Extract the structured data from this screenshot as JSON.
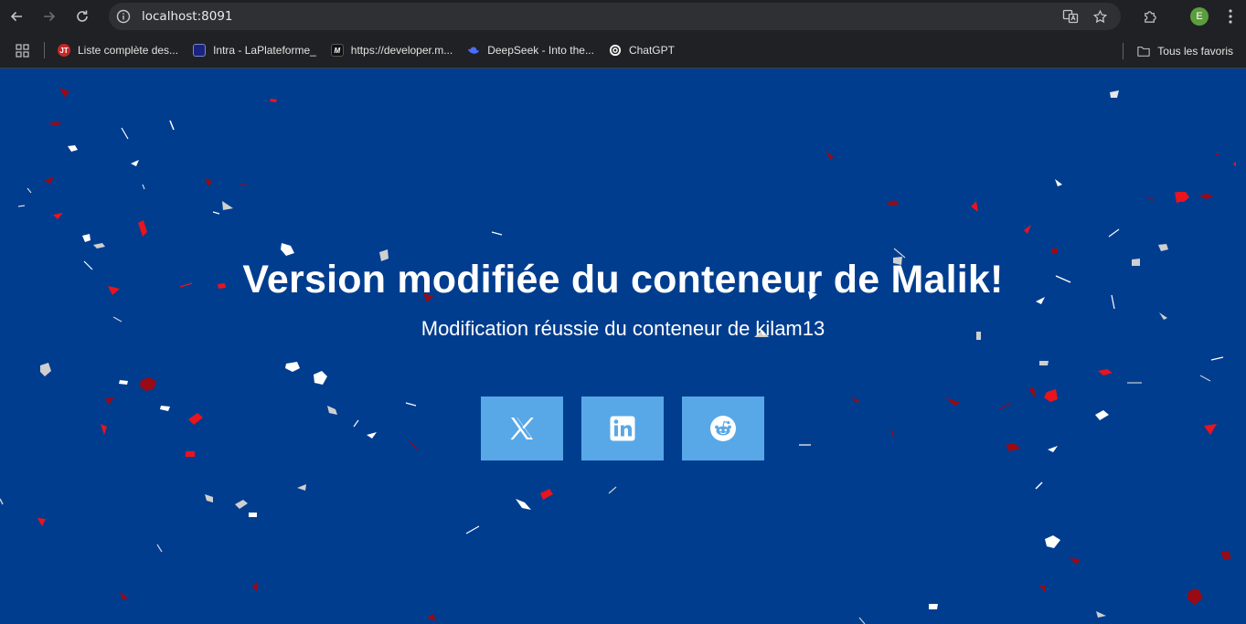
{
  "browser": {
    "url": "localhost:8091",
    "avatar_letter": "E",
    "icons": {
      "back": "arrow-left-icon",
      "forward": "arrow-right-icon",
      "reload": "reload-icon",
      "site_info": "site-info-icon",
      "translate": "translate-icon",
      "bookmark": "star-icon",
      "extensions": "puzzle-icon",
      "menu": "kebab-menu-icon"
    }
  },
  "bookmarks": {
    "items": [
      {
        "label": "Liste complète des...",
        "icon": "jt-favicon",
        "color": "#c62828"
      },
      {
        "label": "Intra - LaPlateforme_",
        "icon": "laplateforme-favicon",
        "color": "#1a237e"
      },
      {
        "label": "https://developer.m...",
        "icon": "mdn-favicon",
        "color": "#111111"
      },
      {
        "label": "DeepSeek - Into the...",
        "icon": "deepseek-favicon",
        "color": "#4d6bfe"
      },
      {
        "label": "ChatGPT",
        "icon": "chatgpt-favicon",
        "color": "#202124"
      }
    ],
    "all_bookmarks_label": "Tous les favoris"
  },
  "page": {
    "title": "Version modifiée du conteneur de Malik!",
    "subtitle": "Modification réussie du conteneur de kilam13",
    "background_color": "#003d8f",
    "share_button_color": "#58a8e8",
    "share_buttons": [
      {
        "name": "x",
        "icon": "x-logo-icon"
      },
      {
        "name": "linkedin",
        "icon": "linkedin-logo-icon"
      },
      {
        "name": "reddit",
        "icon": "reddit-logo-icon"
      }
    ],
    "confetti_colors": [
      "#ffffff",
      "#d0d0d0",
      "#e8141e",
      "#9a0a14"
    ]
  }
}
